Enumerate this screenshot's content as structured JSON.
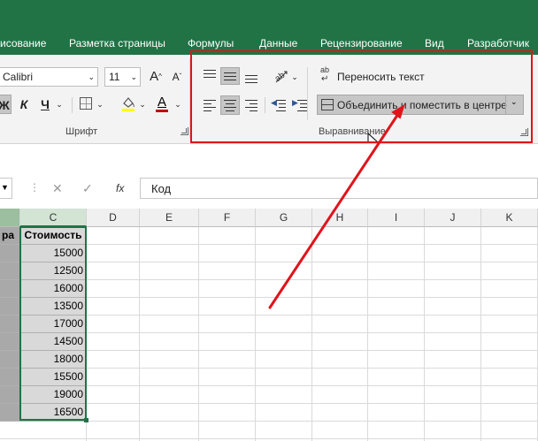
{
  "tabs": [
    "исование",
    "Разметка страницы",
    "Формулы",
    "Данные",
    "Рецензирование",
    "Вид",
    "Разработчик"
  ],
  "font_group": {
    "font_name": "Calibri",
    "font_size": "11",
    "grow_label": "A",
    "shrink_label": "A",
    "bold_label": "Ж",
    "italic_label": "К",
    "underline_label": "Ч",
    "font_color_label": "A",
    "group_label": "Шрифт"
  },
  "alignment_group": {
    "wrap_text_label": "Переносить текст",
    "wrap_text_icon_glyph": "ab",
    "merge_center_label": "Объединить и поместить в центре",
    "group_label": "Выравнивание"
  },
  "formula_bar": {
    "cancel_glyph": "✕",
    "enter_glyph": "✓",
    "fx_label": "fx",
    "content": "Код"
  },
  "columns": [
    "C",
    "D",
    "E",
    "F",
    "G",
    "H",
    "I",
    "J",
    "K"
  ],
  "column_c_header": "Стоимость",
  "column_b_header_partial": "ра",
  "values": [
    "15000",
    "12500",
    "16000",
    "13500",
    "17000",
    "14500",
    "18000",
    "15500",
    "19000",
    "16500"
  ],
  "colors": {
    "ribbon_green": "#217346",
    "highlight_red": "#e0141b",
    "font_color_red": "#c00000"
  }
}
